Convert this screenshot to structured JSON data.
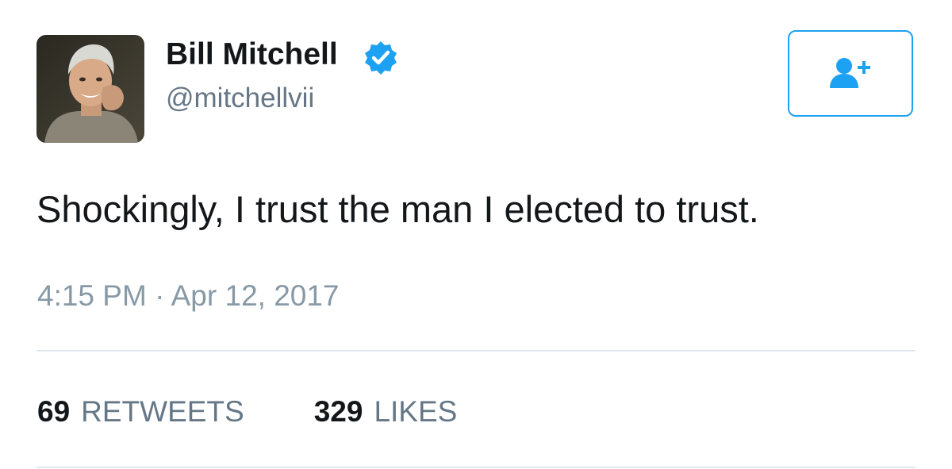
{
  "author": {
    "display_name": "Bill Mitchell",
    "handle": "@mitchellvii",
    "verified": true,
    "avatar": "profile-photo"
  },
  "follow_button": {
    "icon": "add-user-icon"
  },
  "tweet": {
    "text": "Shockingly, I trust the man I elected to trust.",
    "timestamp": "4:15 PM · Apr 12, 2017"
  },
  "stats": {
    "retweets_count": "69",
    "retweets_label": "RETWEETS",
    "likes_count": "329",
    "likes_label": "LIKES"
  },
  "colors": {
    "accent": "#1da1f2",
    "text_primary": "#14171a",
    "text_secondary": "#657786",
    "timestamp": "#8899a6",
    "divider": "#e1e8ed"
  }
}
